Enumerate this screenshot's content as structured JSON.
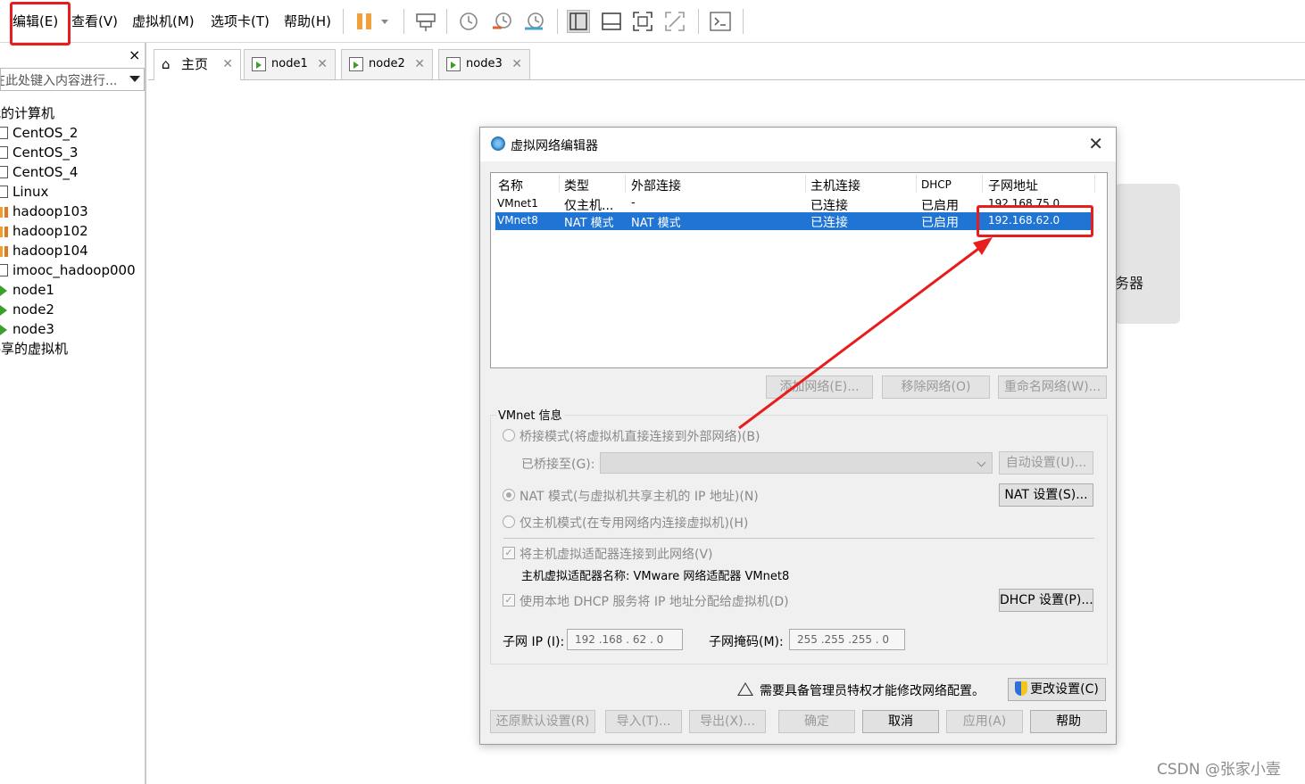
{
  "menubar": {
    "items": [
      "编辑(E)",
      "查看(V)",
      "虚拟机(M)",
      "选项卡(T)",
      "帮助(H)"
    ]
  },
  "toolbar": {
    "icons": [
      "pause-icon",
      "dropdown-icon",
      "send-ctrl-alt-del-icon",
      "snapshot-icon",
      "revert-snapshot-icon",
      "snapshot-manager-icon",
      "library-view-icon",
      "thumbnail-bar-icon",
      "full-screen-icon",
      "unity-icon",
      "console-icon"
    ]
  },
  "sidebar": {
    "close": "×",
    "search_placeholder": "在此处键入内容进行...",
    "root": "我的计算机",
    "items": [
      "CentOS_2",
      "CentOS_3",
      "CentOS_4",
      "Linux",
      "hadoop103",
      "hadoop102",
      "hadoop104",
      "imooc_hadoop000",
      "node1",
      "node2",
      "node3"
    ],
    "shared": "共享的虚拟机"
  },
  "tabs": [
    {
      "label": "主页"
    },
    {
      "label": "node1"
    },
    {
      "label": "node2"
    },
    {
      "label": "node3"
    }
  ],
  "background": {
    "card_text": "务器"
  },
  "dialog": {
    "title": "虚拟网络编辑器",
    "columns": [
      "名称",
      "类型",
      "外部连接",
      "主机连接",
      "DHCP",
      "子网地址"
    ],
    "rows": [
      {
        "name": "VMnet1",
        "type": "仅主机...",
        "external": "-",
        "host": "已连接",
        "dhcp": "已启用",
        "subnet": "192.168.75.0"
      },
      {
        "name": "VMnet8",
        "type": "NAT 模式",
        "external": "NAT 模式",
        "host": "已连接",
        "dhcp": "已启用",
        "subnet": "192.168.62.0"
      }
    ],
    "buttons": {
      "add": "添加网络(E)...",
      "remove": "移除网络(O)",
      "rename": "重命名网络(W)..."
    },
    "info_label": "VMnet 信息",
    "bridge_radio": "桥接模式(将虚拟机直接连接到外部网络)(B)",
    "bridged_to": "已桥接至(G):",
    "auto_settings": "自动设置(U)...",
    "nat_radio": "NAT 模式(与虚拟机共享主机的 IP 地址)(N)",
    "nat_settings": "NAT 设置(S)...",
    "host_only_radio": "仅主机模式(在专用网络内连接虚拟机)(H)",
    "connect_adapter": "将主机虚拟适配器连接到此网络(V)",
    "adapter_name": "主机虚拟适配器名称: VMware 网络适配器 VMnet8",
    "use_dhcp": "使用本地 DHCP 服务将 IP 地址分配给虚拟机(D)",
    "dhcp_settings": "DHCP 设置(P)...",
    "subnet_ip_label": "子网 IP (I):",
    "subnet_ip": "192 .168 . 62  .  0",
    "subnet_mask_label": "子网掩码(M):",
    "subnet_mask": "255 .255 .255 .  0",
    "admin_notice": "需要具备管理员特权才能修改网络配置。",
    "change_settings": "更改设置(C)",
    "footer": {
      "restore": "还原默认设置(R)",
      "import": "导入(T)...",
      "export": "导出(X)...",
      "ok": "确定",
      "cancel": "取消",
      "apply": "应用(A)",
      "help": "帮助"
    }
  },
  "annotations": {
    "highlight_color": "#e81e1e"
  },
  "watermark": "CSDN @张家小壹"
}
